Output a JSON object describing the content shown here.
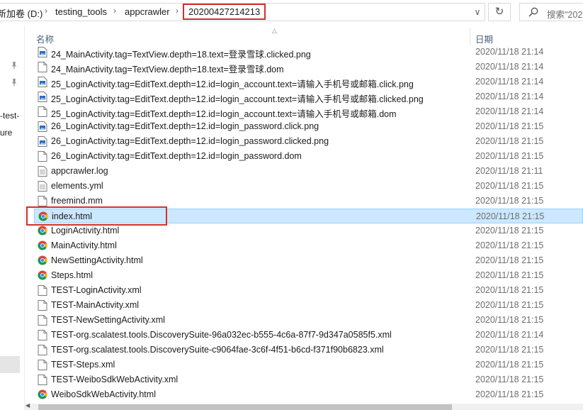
{
  "address": {
    "breadcrumbs": [
      "新加卷 (D:)",
      "testing_tools",
      "appcrawler"
    ],
    "current": "20200427214213",
    "search_placeholder": "搜索\"202"
  },
  "nav": {
    "items": [
      "-test-",
      "ure"
    ]
  },
  "columns": {
    "name": "名称",
    "date": "日期"
  },
  "files": [
    {
      "name": "24_MainActivity.tag=TextView.depth=18.text=登录雪球.clicked.png",
      "date": "2020/11/18 21:14",
      "icon": "image-file-icon"
    },
    {
      "name": "24_MainActivity.tag=TextView.depth=18.text=登录雪球.dom",
      "date": "2020/11/18 21:14",
      "icon": "blank-file-icon"
    },
    {
      "name": "25_LoginActivity.tag=EditText.depth=12.id=login_account.text=请输入手机号或邮箱.click.png",
      "date": "2020/11/18 21:14",
      "icon": "image-file-icon"
    },
    {
      "name": "25_LoginActivity.tag=EditText.depth=12.id=login_account.text=请输入手机号或邮箱.clicked.png",
      "date": "2020/11/18 21:14",
      "icon": "image-file-icon"
    },
    {
      "name": "25_LoginActivity.tag=EditText.depth=12.id=login_account.text=请输入手机号或邮箱.dom",
      "date": "2020/11/18 21:14",
      "icon": "blank-file-icon"
    },
    {
      "name": "26_LoginActivity.tag=EditText.depth=12.id=login_password.click.png",
      "date": "2020/11/18 21:15",
      "icon": "image-file-icon"
    },
    {
      "name": "26_LoginActivity.tag=EditText.depth=12.id=login_password.clicked.png",
      "date": "2020/11/18 21:15",
      "icon": "image-file-icon"
    },
    {
      "name": "26_LoginActivity.tag=EditText.depth=12.id=login_password.dom",
      "date": "2020/11/18 21:15",
      "icon": "blank-file-icon"
    },
    {
      "name": "appcrawler.log",
      "date": "2020/11/18 21:11",
      "icon": "text-file-icon"
    },
    {
      "name": "elements.yml",
      "date": "2020/11/18 21:15",
      "icon": "text-file-icon"
    },
    {
      "name": "freemind.mm",
      "date": "2020/11/18 21:15",
      "icon": "blank-file-icon"
    },
    {
      "name": "index.html",
      "date": "2020/11/18 21:15",
      "icon": "chrome-html-icon",
      "selected": true
    },
    {
      "name": "LoginActivity.html",
      "date": "2020/11/18 21:15",
      "icon": "chrome-html-icon"
    },
    {
      "name": "MainActivity.html",
      "date": "2020/11/18 21:15",
      "icon": "chrome-html-icon"
    },
    {
      "name": "NewSettingActivity.html",
      "date": "2020/11/18 21:15",
      "icon": "chrome-html-icon"
    },
    {
      "name": "Steps.html",
      "date": "2020/11/18 21:15",
      "icon": "chrome-html-icon"
    },
    {
      "name": "TEST-LoginActivity.xml",
      "date": "2020/11/18 21:15",
      "icon": "blank-file-icon"
    },
    {
      "name": "TEST-MainActivity.xml",
      "date": "2020/11/18 21:15",
      "icon": "blank-file-icon"
    },
    {
      "name": "TEST-NewSettingActivity.xml",
      "date": "2020/11/18 21:15",
      "icon": "blank-file-icon"
    },
    {
      "name": "TEST-org.scalatest.tools.DiscoverySuite-96a032ec-b555-4c6a-87f7-9d347a0585f5.xml",
      "date": "2020/11/18 21:14",
      "icon": "blank-file-icon"
    },
    {
      "name": "TEST-org.scalatest.tools.DiscoverySuite-c9064fae-3c6f-4f51-b6cd-f371f90b6823.xml",
      "date": "2020/11/18 21:15",
      "icon": "blank-file-icon"
    },
    {
      "name": "TEST-Steps.xml",
      "date": "2020/11/18 21:15",
      "icon": "blank-file-icon"
    },
    {
      "name": "TEST-WeiboSdkWebActivity.xml",
      "date": "2020/11/18 21:15",
      "icon": "blank-file-icon"
    },
    {
      "name": "WeiboSdkWebActivity.html",
      "date": "2020/11/18 21:15",
      "icon": "chrome-html-icon"
    }
  ],
  "colors": {
    "highlight": "#d0312d",
    "selection": "#cce8ff",
    "selection_border": "#99d1ff"
  }
}
